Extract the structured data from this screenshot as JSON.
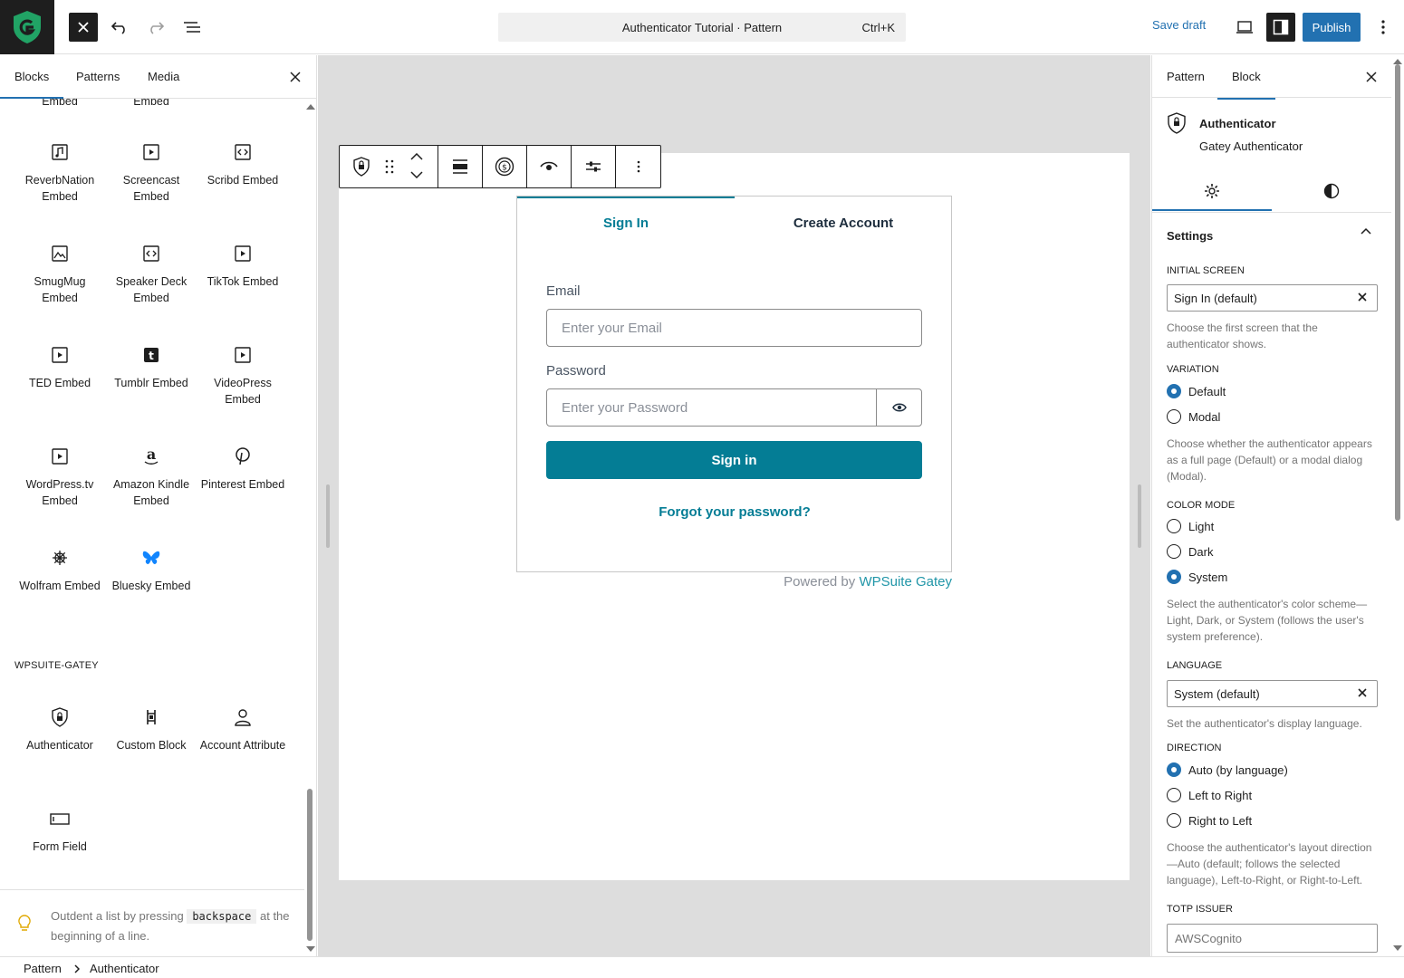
{
  "topbar": {
    "document_title": "Authenticator Tutorial · Pattern",
    "shortcut": "Ctrl+K",
    "save_draft": "Save draft",
    "publish": "Publish"
  },
  "inserter": {
    "tabs": [
      "Blocks",
      "Patterns",
      "Media"
    ],
    "partial_items": [
      "Embed",
      "Embed"
    ],
    "embed_items": [
      {
        "label": "ReverbNation Embed",
        "icon": "embed-audio-icon"
      },
      {
        "label": "Screencast Embed",
        "icon": "embed-video-icon"
      },
      {
        "label": "Scribd Embed",
        "icon": "embed-generic-icon"
      },
      {
        "label": "SmugMug Embed",
        "icon": "embed-photo-icon"
      },
      {
        "label": "Speaker Deck Embed",
        "icon": "embed-generic-icon"
      },
      {
        "label": "TikTok Embed",
        "icon": "embed-video-icon"
      },
      {
        "label": "TED Embed",
        "icon": "embed-video-icon"
      },
      {
        "label": "Tumblr Embed",
        "icon": "tumblr-icon"
      },
      {
        "label": "VideoPress Embed",
        "icon": "embed-video-icon"
      },
      {
        "label": "WordPress.tv Embed",
        "icon": "embed-video-icon"
      },
      {
        "label": "Amazon Kindle Embed",
        "icon": "amazon-icon"
      },
      {
        "label": "Pinterest Embed",
        "icon": "pinterest-icon"
      },
      {
        "label": "Wolfram Embed",
        "icon": "wolfram-icon"
      },
      {
        "label": "Bluesky Embed",
        "icon": "bluesky-icon"
      }
    ],
    "section_label": "WPSUITE-GATEY",
    "gatey_items": [
      {
        "label": "Authenticator",
        "icon": "shield-lock-icon"
      },
      {
        "label": "Custom Block",
        "icon": "custom-block-icon"
      },
      {
        "label": "Account Attribute",
        "icon": "user-icon"
      },
      {
        "label": "Form Field",
        "icon": "form-field-icon"
      }
    ],
    "tip_pre": "Outdent a list by pressing",
    "tip_key": "backspace",
    "tip_post": "at the beginning of a line."
  },
  "authenticator": {
    "tab_signin": "Sign In",
    "tab_create": "Create Account",
    "email_label": "Email",
    "email_placeholder": "Enter your Email",
    "password_label": "Password",
    "password_placeholder": "Enter your Password",
    "submit": "Sign in",
    "forgot": "Forgot your password?",
    "powered_prefix": "Powered by",
    "powered_brand": "WPSuite Gatey"
  },
  "settings": {
    "tabs": [
      "Pattern",
      "Block"
    ],
    "block_title": "Authenticator",
    "block_desc": "Gatey Authenticator",
    "panel_title": "Settings",
    "initial_screen_label": "INITIAL SCREEN",
    "initial_screen_value": "Sign In (default)",
    "initial_screen_help": "Choose the first screen that the authenticator shows.",
    "variation_label": "VARIATION",
    "variation_options": [
      "Default",
      "Modal"
    ],
    "variation_selected": "Default",
    "variation_help": "Choose whether the authenticator appears as a full page (Default) or a modal dialog (Modal).",
    "color_mode_label": "COLOR MODE",
    "color_mode_options": [
      "Light",
      "Dark",
      "System"
    ],
    "color_mode_selected": "System",
    "color_mode_help": "Select the authenticator's color scheme—Light, Dark, or System (follows the user's system preference).",
    "language_label": "LANGUAGE",
    "language_value": "System (default)",
    "language_help": "Set the authenticator's display language.",
    "direction_label": "DIRECTION",
    "direction_options": [
      "Auto (by language)",
      "Left to Right",
      "Right to Left"
    ],
    "direction_selected": "Auto (by language)",
    "direction_help": "Choose the authenticator's layout direction—Auto (default; follows the selected language), Left-to-Right, or Right-to-Left.",
    "totp_label": "TOTP ISSUER",
    "totp_value": "AWSCognito"
  },
  "footer": {
    "crumbs": [
      "Pattern",
      "Authenticator"
    ]
  },
  "colors": {
    "accent": "#2271b1",
    "auth_brand": "#047d95",
    "dark": "#1e1e1e",
    "logo_green": "#21a365"
  }
}
